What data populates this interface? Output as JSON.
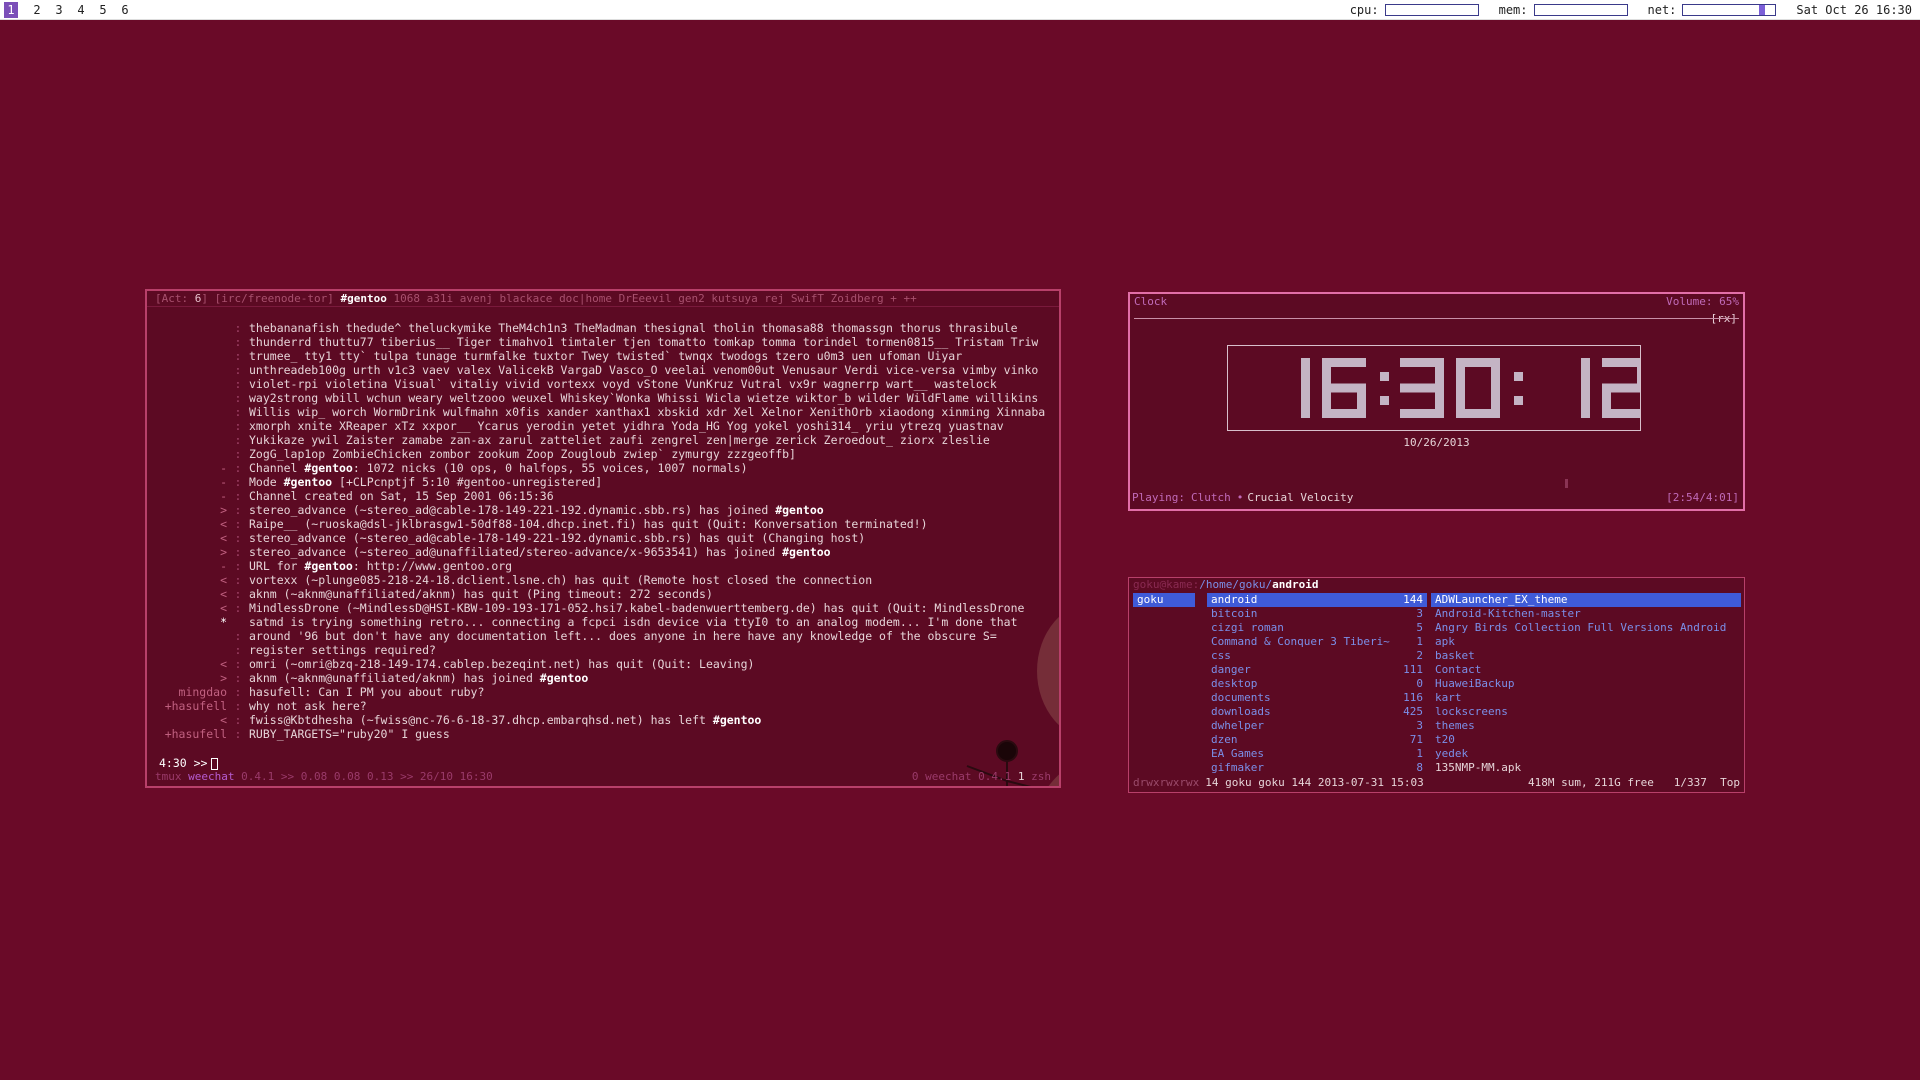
{
  "topbar": {
    "workspaces": [
      "1",
      "2",
      "3",
      "4",
      "5",
      "6"
    ],
    "active_workspace": "1",
    "cpu_label": "cpu:",
    "mem_label": "mem:",
    "net_label": "net:",
    "cpu_fraction": 0.0,
    "mem_fraction": 0.0,
    "net_fraction": 0.9,
    "datetime": "Sat Oct 26 16:30"
  },
  "weechat": {
    "buffer_bar": {
      "act_prefix": "[Act: ",
      "act_count": "6",
      "act_suffix": "]",
      "server": "[irc/freenode-tor]",
      "channel": "#gentoo",
      "nick_count": "1068",
      "items": [
        "a31i",
        "avenj",
        "blackace",
        "doc|home",
        "DrEeevil",
        "gen2",
        "kutsuya",
        "rej",
        "SwifT",
        "Zoidberg"
      ],
      "more": "+ ++"
    },
    "lines": [
      {
        "nick": "",
        "sep": ":",
        "msg": "thebananafish thedude^ theluckymike TheM4ch1n3 TheMadman thesignal tholin thomasa88 thomassgn thorus thrasibule"
      },
      {
        "nick": "",
        "sep": ":",
        "msg": "thunderrd thuttu77 tiberius__ Tiger timahvo1 timtaler tjen tomatto tomkap tomma torindel tormen0815__ Tristam Triw"
      },
      {
        "nick": "",
        "sep": ":",
        "msg": "trumee_ tty1 tty` tulpa tunage turmfalke tuxtor Twey twisted` twnqx twodogs tzero u0m3 uen ufoman Uiyar"
      },
      {
        "nick": "",
        "sep": ":",
        "msg": "unthreadeb100g urth v1c3 vaev valex ValicekB VargaD Vasco_O veelai venom00ut Venusaur Verdi vice-versa vimby vinko"
      },
      {
        "nick": "",
        "sep": ":",
        "msg": "violet-rpi violetina Visual` vitaliy vivid vortexx voyd vStone VunKruz Vutral vx9r wagnerrp wart__ wastelock"
      },
      {
        "nick": "",
        "sep": ":",
        "msg": "way2strong wbill wchun weary weltzooo weuxel Whiskey`Wonka Whissi Wicla wietze wiktor_b wilder WildFlame willikins"
      },
      {
        "nick": "",
        "sep": ":",
        "msg": "Willis wip_ worch WormDrink wulfmahn x0fis xander xanthax1 xbskid xdr Xel Xelnor XenithOrb xiaodong xinming Xinnaba"
      },
      {
        "nick": "",
        "sep": ":",
        "msg": "xmorph xnite XReaper xTz xxpor__ Ycarus yerodin yetet yidhra Yoda_HG Yog yokel yoshi314_ yriu ytrezq yuastnav"
      },
      {
        "nick": "",
        "sep": ":",
        "msg": "Yukikaze ywil Zaister zamabe zan-ax zarul zatteliet zaufi zengrel zen|merge zerick Zeroedout_ ziorx zleslie"
      },
      {
        "nick": "",
        "sep": ":",
        "msg": "ZogG_lap1op ZombieChicken zombor zookum Zoop Zougloub zwiep` zymurgy zzzgeoffb]"
      },
      {
        "nick": "-",
        "sep": ":",
        "msg": "Channel #gentoo: 1072 nicks (10 ops, 0 halfops, 55 voices, 1007 normals)"
      },
      {
        "nick": "-",
        "sep": ":",
        "msg": "Mode #gentoo [+CLPcnptjf 5:10 #gentoo-unregistered]"
      },
      {
        "nick": "-",
        "sep": ":",
        "msg": "Channel created on Sat, 15 Sep 2001 06:15:36"
      },
      {
        "nick": ">",
        "sep": ":",
        "msg": "stereo_advance (~stereo_ad@cable-178-149-221-192.dynamic.sbb.rs) has joined #gentoo"
      },
      {
        "nick": "<",
        "sep": ":",
        "msg": "Raipe__ (~ruoska@dsl-jklbrasgw1-50df88-104.dhcp.inet.fi) has quit (Quit: Konversation terminated!)"
      },
      {
        "nick": "<",
        "sep": ":",
        "msg": "stereo_advance (~stereo_ad@cable-178-149-221-192.dynamic.sbb.rs) has quit (Changing host)"
      },
      {
        "nick": ">",
        "sep": ":",
        "msg": "stereo_advance (~stereo_ad@unaffiliated/stereo-advance/x-9653541) has joined #gentoo"
      },
      {
        "nick": "-",
        "sep": ":",
        "msg": "URL for #gentoo: http://www.gentoo.org"
      },
      {
        "nick": "<",
        "sep": ":",
        "msg": "vortexx (~plunge085-218-24-18.dclient.lsne.ch) has quit (Remote host closed the connection"
      },
      {
        "nick": "<",
        "sep": ":",
        "msg": "aknm (~aknm@unaffiliated/aknm) has quit (Ping timeout: 272 seconds)"
      },
      {
        "nick": "<",
        "sep": ":",
        "msg": "MindlessDrone (~MindlessD@HSI-KBW-109-193-171-052.hsi7.kabel-badenwuerttemberg.de) has quit (Quit: MindlessDrone"
      },
      {
        "nick": "*",
        "sep": "",
        "msg": "satmd is trying something retro... connecting a fcpci isdn device via ttyI0 to an analog modem... I'm done that"
      },
      {
        "nick": "",
        "sep": ":",
        "msg": "around '96 but don't have any documentation left... does anyone in here have any knowledge of the obscure S="
      },
      {
        "nick": "",
        "sep": ":",
        "msg": "register settings required?"
      },
      {
        "nick": "<",
        "sep": ":",
        "msg": "omri (~omri@bzq-218-149-174.cablep.bezeqint.net) has quit (Quit: Leaving)"
      },
      {
        "nick": ">",
        "sep": ":",
        "msg": "aknm (~aknm@unaffiliated/aknm) has joined #gentoo"
      },
      {
        "nick": "mingdao",
        "sep": ":",
        "msg": "hasufell: Can I PM you about ruby?"
      },
      {
        "nick": "+hasufell",
        "sep": ":",
        "msg": "why not ask here?"
      },
      {
        "nick": "<",
        "sep": ":",
        "msg": "fwiss@Kbtdhesha (~fwiss@nc-76-6-18-37.dhcp.embarqhsd.net) has left #gentoo"
      },
      {
        "nick": "+hasufell",
        "sep": ":",
        "msg": "RUBY_TARGETS=\"ruby20\" I guess"
      }
    ],
    "input_prompt": "4:30 >>",
    "status_left_a": "tmux",
    "status_left_b": "weechat",
    "status_left_c": "0.4.1",
    "status_left_d": ">> 0.08 0.08 0.13 >> 26/10 16:30",
    "status_right_a": "0 weechat 0.4.1",
    "status_right_b": "1",
    "status_right_c": "zsh"
  },
  "clock": {
    "title": "Clock",
    "volume": "Volume: 65%",
    "rx": "[rx]",
    "time": "16:30: 12",
    "date": "10/26/2013",
    "playing_label": "Playing:",
    "artist": "Clutch",
    "separator": "•",
    "album": "Crucial Velocity",
    "progress": "[2:54/4:01]"
  },
  "ranger": {
    "user_host": "goku@kame:",
    "path_dir": "/home/goku/",
    "path_cur": "android",
    "col1": [
      {
        "name": "goku",
        "selected": true
      }
    ],
    "col2": [
      {
        "name": "android",
        "count": "144",
        "selected": true
      },
      {
        "name": "bitcoin",
        "count": "3"
      },
      {
        "name": "cizgi roman",
        "count": "5"
      },
      {
        "name": "Command & Conquer 3 Tiberi~",
        "count": "1"
      },
      {
        "name": "css",
        "count": "2"
      },
      {
        "name": "danger",
        "count": "111"
      },
      {
        "name": "desktop",
        "count": "0"
      },
      {
        "name": "documents",
        "count": "116"
      },
      {
        "name": "downloads",
        "count": "425"
      },
      {
        "name": "dwhelper",
        "count": "3"
      },
      {
        "name": "dzen",
        "count": "71"
      },
      {
        "name": "EA Games",
        "count": "1"
      },
      {
        "name": "gifmaker",
        "count": "8"
      }
    ],
    "col3": [
      {
        "name": "ADWLauncher_EX_theme",
        "selected": true
      },
      {
        "name": "Android-Kitchen-master"
      },
      {
        "name": "Angry Birds Collection Full Versions Android"
      },
      {
        "name": "apk"
      },
      {
        "name": "basket"
      },
      {
        "name": "Contact"
      },
      {
        "name": "HuaweiBackup"
      },
      {
        "name": "kart"
      },
      {
        "name": "lockscreens"
      },
      {
        "name": "themes"
      },
      {
        "name": "t20"
      },
      {
        "name": "yedek"
      },
      {
        "name": "135NMP-MM.apk",
        "file": true
      }
    ],
    "footer_perm": "drwxrwxrwx",
    "footer_info": "14 goku goku 144 2013-07-31 15:03",
    "footer_sum": "418M sum, 211G free",
    "footer_pos": "1/337",
    "footer_top": "Top"
  }
}
